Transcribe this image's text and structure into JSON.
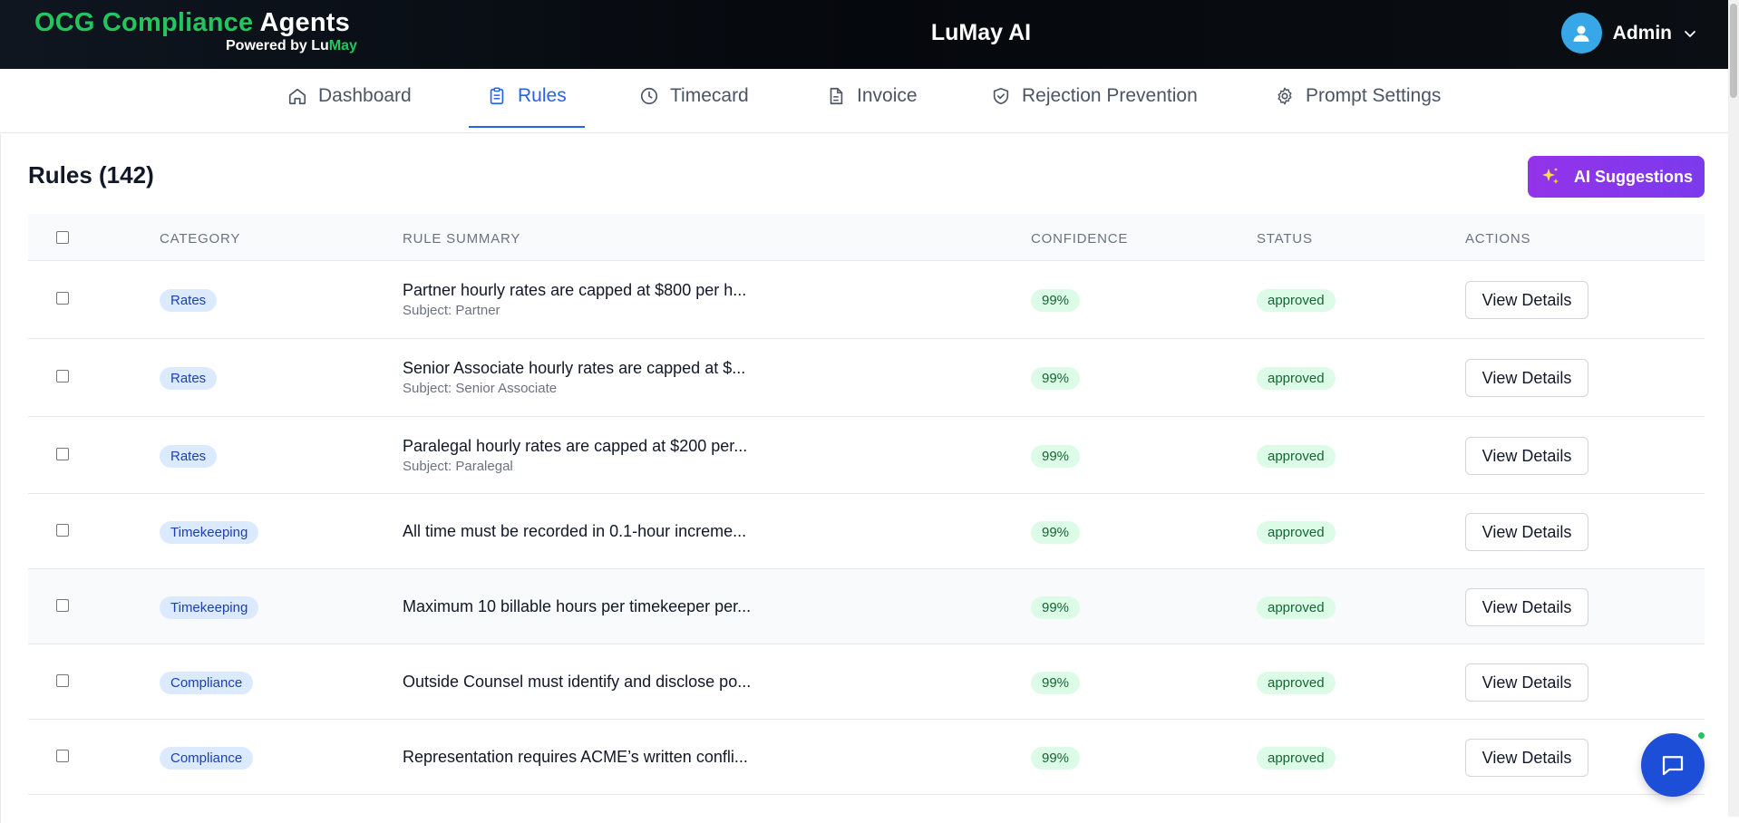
{
  "header": {
    "brand_part1": "OCG Compliance",
    "brand_part2": "Agents",
    "powered_prefix": "Powered by ",
    "powered_lu": "Lu",
    "powered_may": "May",
    "app_title": "LuMay AI",
    "user_name": "Admin"
  },
  "nav": {
    "tabs": [
      {
        "label": "Dashboard",
        "icon": "home-icon"
      },
      {
        "label": "Rules",
        "icon": "clipboard-icon",
        "active": true
      },
      {
        "label": "Timecard",
        "icon": "clock-icon"
      },
      {
        "label": "Invoice",
        "icon": "document-icon"
      },
      {
        "label": "Rejection Prevention",
        "icon": "shield-check-icon"
      },
      {
        "label": "Prompt Settings",
        "icon": "gear-icon"
      }
    ]
  },
  "page": {
    "title": "Rules (142)",
    "ai_button_label": "AI Suggestions"
  },
  "table": {
    "columns": {
      "category": "CATEGORY",
      "summary": "RULE SUMMARY",
      "confidence": "CONFIDENCE",
      "status": "STATUS",
      "actions": "ACTIONS"
    },
    "rows": [
      {
        "category": "Rates",
        "summary": "Partner hourly rates are capped at $800 per h...",
        "subject": "Subject: Partner",
        "confidence": "99%",
        "status": "approved",
        "action": "View Details"
      },
      {
        "category": "Rates",
        "summary": "Senior Associate hourly rates are capped at $...",
        "subject": "Subject: Senior Associate",
        "confidence": "99%",
        "status": "approved",
        "action": "View Details"
      },
      {
        "category": "Rates",
        "summary": "Paralegal hourly rates are capped at $200 per...",
        "subject": "Subject: Paralegal",
        "confidence": "99%",
        "status": "approved",
        "action": "View Details"
      },
      {
        "category": "Timekeeping",
        "summary": "All time must be recorded in 0.1-hour increme...",
        "subject": "",
        "confidence": "99%",
        "status": "approved",
        "action": "View Details"
      },
      {
        "category": "Timekeeping",
        "summary": "Maximum 10 billable hours per timekeeper per...",
        "subject": "",
        "confidence": "99%",
        "status": "approved",
        "action": "View Details"
      },
      {
        "category": "Compliance",
        "summary": "Outside Counsel must identify and disclose po...",
        "subject": "",
        "confidence": "99%",
        "status": "approved",
        "action": "View Details"
      },
      {
        "category": "Compliance",
        "summary": "Representation requires ACME’s written confli...",
        "subject": "",
        "confidence": "99%",
        "status": "approved",
        "action": "View Details"
      }
    ]
  },
  "colors": {
    "brand_green": "#22c55e",
    "accent_blue": "#2563eb",
    "ai_purple": "#9333ea",
    "approved_green": "#166534",
    "category_blue": "#1e40af"
  }
}
